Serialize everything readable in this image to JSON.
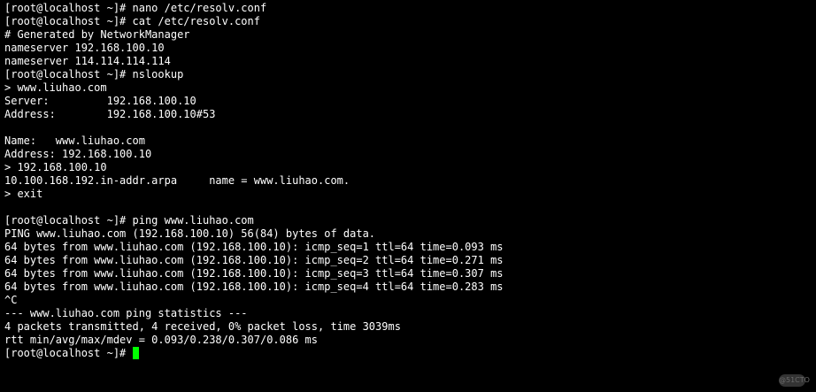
{
  "terminal": {
    "lines": [
      "[root@localhost ~]# nano /etc/resolv.conf",
      "[root@localhost ~]# cat /etc/resolv.conf",
      "# Generated by NetworkManager",
      "nameserver 192.168.100.10",
      "nameserver 114.114.114.114",
      "[root@localhost ~]# nslookup",
      "> www.liuhao.com",
      "Server:         192.168.100.10",
      "Address:        192.168.100.10#53",
      "",
      "Name:   www.liuhao.com",
      "Address: 192.168.100.10",
      "> 192.168.100.10",
      "10.100.168.192.in-addr.arpa     name = www.liuhao.com.",
      "> exit",
      "",
      "[root@localhost ~]# ping www.liuhao.com",
      "PING www.liuhao.com (192.168.100.10) 56(84) bytes of data.",
      "64 bytes from www.liuhao.com (192.168.100.10): icmp_seq=1 ttl=64 time=0.093 ms",
      "64 bytes from www.liuhao.com (192.168.100.10): icmp_seq=2 ttl=64 time=0.271 ms",
      "64 bytes from www.liuhao.com (192.168.100.10): icmp_seq=3 ttl=64 time=0.307 ms",
      "64 bytes from www.liuhao.com (192.168.100.10): icmp_seq=4 ttl=64 time=0.283 ms",
      "^C",
      "--- www.liuhao.com ping statistics ---",
      "4 packets transmitted, 4 received, 0% packet loss, time 3039ms",
      "rtt min/avg/max/mdev = 0.093/0.238/0.307/0.086 ms"
    ],
    "prompt": "[root@localhost ~]# ",
    "watermark": "@51CTO",
    "colors": {
      "background": "#000000",
      "foreground": "#ffffff",
      "cursor": "#00ff00"
    }
  }
}
